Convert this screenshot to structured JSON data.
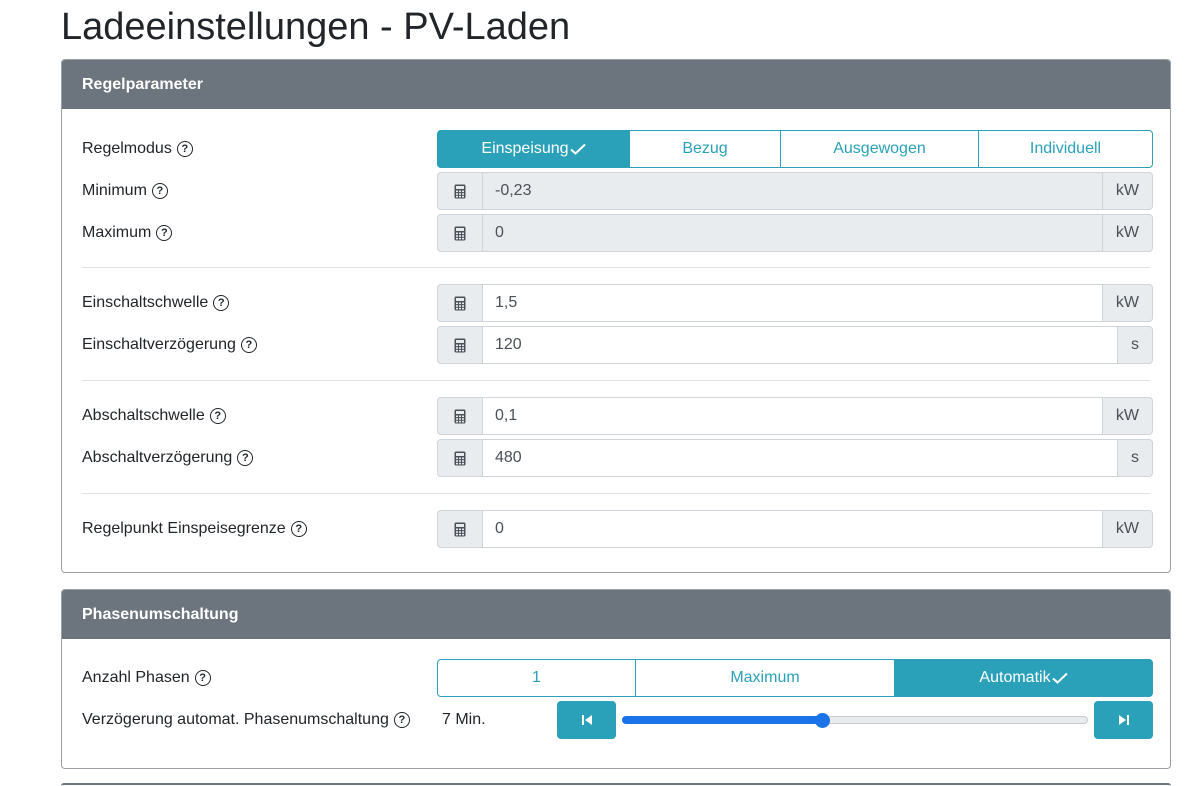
{
  "page_title": "Ladeeinstellungen - PV-Laden",
  "colors": {
    "accent": "#2aa1b8",
    "header_bg": "#6c757d",
    "slider": "#1a73e8"
  },
  "regel": {
    "title": "Regelparameter",
    "regelmodus": {
      "label": "Regelmodus",
      "options": [
        "Einspeisung",
        "Bezug",
        "Ausgewogen",
        "Individuell"
      ],
      "selected": "Einspeisung"
    },
    "minimum": {
      "label": "Minimum",
      "value": "-0,23",
      "unit": "kW"
    },
    "maximum": {
      "label": "Maximum",
      "value": "0",
      "unit": "kW"
    },
    "einschaltschwelle": {
      "label": "Einschaltschwelle",
      "value": "1,5",
      "unit": "kW"
    },
    "einschaltverzoegerung": {
      "label": "Einschaltverzögerung",
      "value": "120",
      "unit": "s"
    },
    "abschaltschwelle": {
      "label": "Abschaltschwelle",
      "value": "0,1",
      "unit": "kW"
    },
    "abschaltverzoegerung": {
      "label": "Abschaltverzögerung",
      "value": "480",
      "unit": "s"
    },
    "regelpunkt": {
      "label": "Regelpunkt Einspeisegrenze",
      "value": "0",
      "unit": "kW"
    }
  },
  "phasen": {
    "title": "Phasenumschaltung",
    "anzahl": {
      "label": "Anzahl Phasen",
      "options": [
        "1",
        "Maximum",
        "Automatik"
      ],
      "selected": "Automatik"
    },
    "verzoegerung": {
      "label": "Verzögerung automat. Phasenumschaltung",
      "value_text": "7 Min.",
      "fraction": 0.43
    }
  },
  "icons": {
    "help": "question-circle-icon",
    "calculator": "calculator-icon",
    "check": "check-icon",
    "step_back": "step-backward-icon",
    "step_forward": "step-forward-icon"
  }
}
